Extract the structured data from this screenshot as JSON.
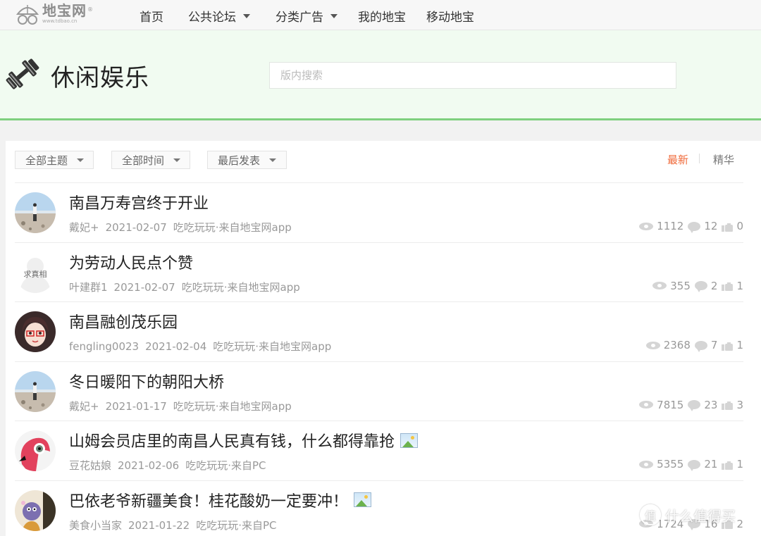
{
  "nav": {
    "logo_name": "地宝网",
    "logo_reg": "®",
    "logo_url": "www.tdbao.cn",
    "items": [
      "首页",
      "公共论坛",
      "分类广告",
      "我的地宝",
      "移动地宝"
    ]
  },
  "header": {
    "title": "休闲娱乐",
    "search_placeholder": "版内搜索"
  },
  "filters": {
    "topic": "全部主题",
    "time": "全部时间",
    "order": "最后发表",
    "sort_new": "最新",
    "sort_best": "精华"
  },
  "posts": [
    {
      "title": "南昌万寿宫终于开业",
      "author": "戴妃+",
      "date": "2021-02-07",
      "category": "吃吃玩玩",
      "source": "·来自地宝网app",
      "views": "1112",
      "replies": "12",
      "likes": "0",
      "has_image": false,
      "avatar": "beach-avatar"
    },
    {
      "title": "为劳动人民点个赞",
      "author": "叶建群1",
      "date": "2021-02-07",
      "category": "吃吃玩玩",
      "source": "·来自地宝网app",
      "views": "355",
      "replies": "2",
      "likes": "1",
      "has_image": false,
      "avatar": "placeholder-avatar",
      "avatar_text": "求真相"
    },
    {
      "title": "南昌融创茂乐园",
      "author": "fengling0023",
      "date": "2021-02-04",
      "category": "吃吃玩玩",
      "source": "·来自地宝网app",
      "views": "2368",
      "replies": "7",
      "likes": "1",
      "has_image": false,
      "avatar": "anime-girl-avatar"
    },
    {
      "title": "冬日暖阳下的朝阳大桥",
      "author": "戴妃+",
      "date": "2021-01-17",
      "category": "吃吃玩玩",
      "source": "·来自地宝网app",
      "views": "7815",
      "replies": "23",
      "likes": "3",
      "has_image": false,
      "avatar": "beach-avatar"
    },
    {
      "title": "山姆会员店里的南昌人民真有钱，什么都得靠抢",
      "author": "豆花姑娘",
      "date": "2021-02-06",
      "category": "吃吃玩玩",
      "source": "·来自PC",
      "views": "5355",
      "replies": "21",
      "likes": "1",
      "has_image": true,
      "avatar": "pink-bird-avatar"
    },
    {
      "title": "巴依老爷新疆美食！桂花酸奶一定要冲！",
      "author": "美食小当家",
      "date": "2021-01-22",
      "category": "吃吃玩玩",
      "source": "·来自PC",
      "views": "1724",
      "replies": "16",
      "likes": "2",
      "has_image": true,
      "avatar": "cartoon-avatar"
    }
  ],
  "watermark": {
    "symbol": "值",
    "text": "什么值得买"
  }
}
